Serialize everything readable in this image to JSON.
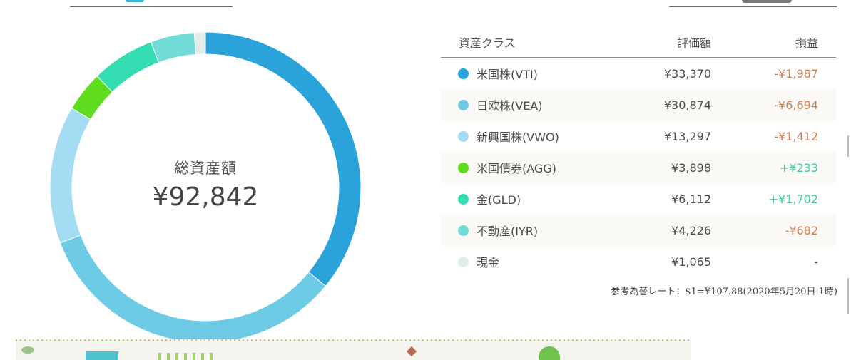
{
  "chart_data": {
    "type": "pie",
    "center_label": "総資産額",
    "center_value": "¥92,842",
    "categories": [
      "米国株(VTI)",
      "日欧株(VEA)",
      "新興国株(VWO)",
      "米国債券(AGG)",
      "金(GLD)",
      "不動産(IYR)",
      "現金"
    ],
    "values": [
      33370,
      30874,
      13297,
      3898,
      6112,
      4226,
      1065
    ],
    "colors": [
      "#29a3d9",
      "#6ecbe6",
      "#a3dcf3",
      "#5fdc1e",
      "#33ddb1",
      "#72dcd8",
      "#e3ece9"
    ]
  },
  "table": {
    "headers": {
      "asset_class": "資産クラス",
      "value": "評価額",
      "pl": "損益"
    },
    "rows": [
      {
        "label": "米国株(VTI)",
        "value": "¥33,370",
        "pl": "-¥1,987",
        "pl_sign": "neg",
        "color": "#29a3d9"
      },
      {
        "label": "日欧株(VEA)",
        "value": "¥30,874",
        "pl": "-¥6,694",
        "pl_sign": "neg",
        "color": "#6ecbe6"
      },
      {
        "label": "新興国株(VWO)",
        "value": "¥13,297",
        "pl": "-¥1,412",
        "pl_sign": "neg",
        "color": "#a3dcf3"
      },
      {
        "label": "米国債券(AGG)",
        "value": "¥3,898",
        "pl": "+¥233",
        "pl_sign": "pos",
        "color": "#5fdc1e"
      },
      {
        "label": "金(GLD)",
        "value": "¥6,112",
        "pl": "+¥1,702",
        "pl_sign": "pos",
        "color": "#33ddb1"
      },
      {
        "label": "不動産(IYR)",
        "value": "¥4,226",
        "pl": "-¥682",
        "pl_sign": "neg",
        "color": "#72dcd8"
      },
      {
        "label": "現金",
        "value": "¥1,065",
        "pl": "-",
        "pl_sign": "zero",
        "color": "#e3ece9"
      }
    ],
    "fx_note": "参考為替レート：$1=¥107.88(2020年5月20日 1時)"
  }
}
